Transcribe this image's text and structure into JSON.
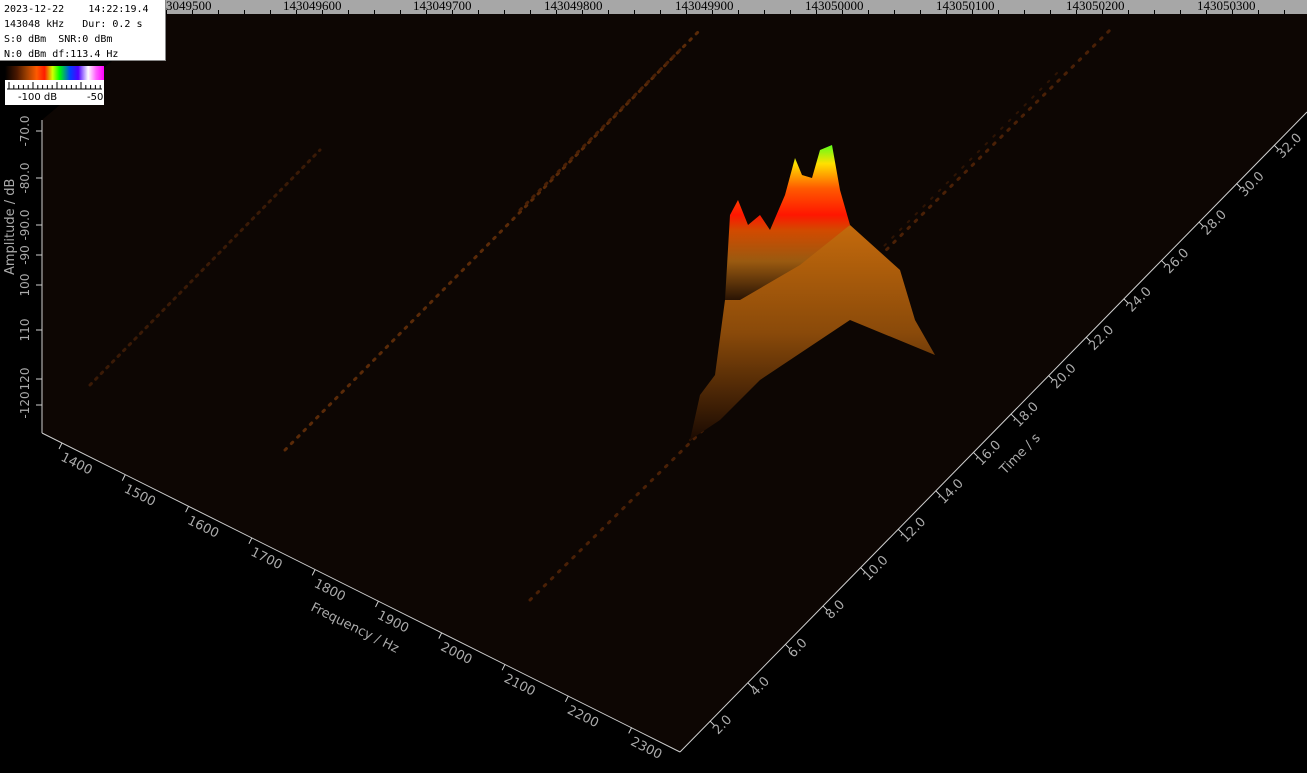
{
  "info": {
    "date": "2023-12-22",
    "time": "14:22:19.4",
    "center_freq": "143048 kHz",
    "duration": "Dur: 0.2 s",
    "signal": "S:0 dBm",
    "snr": "SNR:0 dBm",
    "noise": "N:0 dBm",
    "df": "df:113.4 Hz"
  },
  "ruler": {
    "labels": [
      "3049500",
      "143049600",
      "143049700",
      "143049800",
      "143049900",
      "143050000",
      "143050100",
      "143050200",
      "143050300"
    ]
  },
  "colorbar": {
    "min_label": "-100 dB",
    "max_label": "-50"
  },
  "axes": {
    "amplitude_label": "Amplitude / dB",
    "amplitude_ticks": [
      "-70.0",
      "-80.0",
      "-90.0",
      "-90",
      "100",
      "110",
      "120",
      "-120"
    ],
    "frequency_label": "Frequency / Hz",
    "frequency_ticks": [
      "1400",
      "1500",
      "1600",
      "1700",
      "1800",
      "1900",
      "2000",
      "2100",
      "2200",
      "2300"
    ],
    "time_label": "Time / s",
    "time_ticks": [
      "2.0",
      "4.0",
      "6.0",
      "8.0",
      "10.0",
      "12.0",
      "14.0",
      "16.0",
      "18.0",
      "20.0",
      "22.0",
      "24.0",
      "26.0",
      "28.0",
      "30.0",
      "32.0"
    ]
  },
  "colors": {
    "background": "#000000",
    "floor": "#0f0804",
    "axis": "#cfcfcf",
    "ruler_bg": "#a7a7a7"
  }
}
